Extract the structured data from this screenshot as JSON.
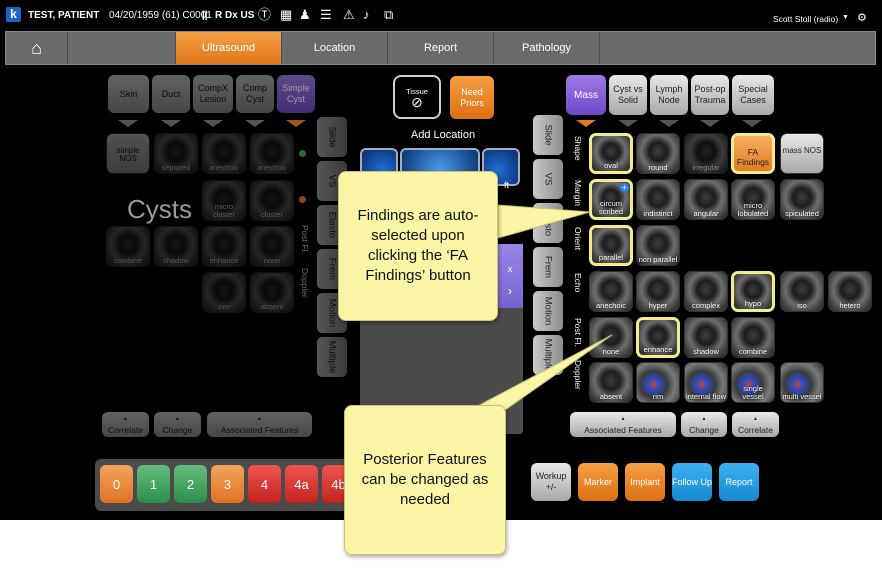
{
  "header": {
    "logo": "k",
    "patient_name": "TEST, PATIENT",
    "patient_info": "04/20/1959 (61) C0001",
    "separator": "||",
    "mode": "R Dx US",
    "user": "Scott Stoll (radio)"
  },
  "nav": {
    "tabs": [
      "Ultrasound",
      "Location",
      "Report",
      "Pathology"
    ],
    "active": "Ultrasound"
  },
  "left_panel": {
    "categories": [
      {
        "label": "Skin",
        "style": "gray"
      },
      {
        "label": "Duct",
        "style": "gray"
      },
      {
        "label": "CompX Lesion",
        "style": "gray"
      },
      {
        "label": "Comp Cyst",
        "style": "gray"
      },
      {
        "label": "Simple Cyst",
        "style": "purple"
      }
    ],
    "side_tabs": [
      "Slide",
      "VS",
      "Elasto",
      "Frem",
      "Motion",
      "Multiple"
    ],
    "row_labels": [
      "Post Fl.",
      "Doppler"
    ],
    "big_label": "Cysts",
    "tiles": [
      "simple NOS",
      "septated",
      "anechoic",
      "micro cluster",
      "cluster",
      "combine",
      "shadow",
      "enhance",
      "none",
      "rim",
      "absent"
    ],
    "bottom_buttons": [
      "Correlate",
      "Change",
      "Associated Features"
    ]
  },
  "middle_panel": {
    "tissue_label": "Tissue",
    "need_priors": "Need Priors",
    "add_location": "Add Location",
    "partial_text": "ft",
    "partial_x": "x"
  },
  "right_panel": {
    "categories": [
      {
        "label": "Mass",
        "style": "purple"
      },
      {
        "label": "Cyst vs Solid",
        "style": "gray"
      },
      {
        "label": "Lymph Node",
        "style": "gray"
      },
      {
        "label": "Post-op Trauma",
        "style": "gray"
      },
      {
        "label": "Special Cases",
        "style": "gray"
      }
    ],
    "side_tabs": [
      "Slide",
      "VS",
      "Elasto",
      "Frem",
      "Motion",
      "Multiple"
    ],
    "row_labels": [
      "Shape",
      "Margin",
      "Orient",
      "Echo",
      "Post Fl.",
      "Doppler"
    ],
    "shape": [
      "oval",
      "round",
      "irregular",
      "FA Findings",
      "mass NOS"
    ],
    "margin": [
      "circum scribed",
      "indistinct",
      "angular",
      "micro lobulated",
      "spiculated"
    ],
    "orient": [
      "parallel",
      "non parallel"
    ],
    "echo": [
      "anechoic",
      "hyper",
      "complex",
      "hypo",
      "iso",
      "hetero"
    ],
    "post": [
      "none",
      "enhance",
      "shadow",
      "combine"
    ],
    "doppler": [
      "absent",
      "rim",
      "internal flow",
      "single vessel",
      "multi vessel"
    ],
    "bottom_buttons": [
      "Associated Features",
      "Change",
      "Correlate"
    ]
  },
  "birads": [
    "0",
    "1",
    "2",
    "3",
    "4",
    "4a",
    "4b"
  ],
  "actions": [
    "Workup +/-",
    "Marker",
    "Implant",
    "Follow Up",
    "Report"
  ],
  "callouts": {
    "top": "Findings are auto-selected upon clicking the ‘FA Findings’ button",
    "bottom": "Posterior Features can be changed as needed"
  },
  "colors": {
    "accent_orange": "#e27a24",
    "accent_purple": "#7b56d4",
    "selected_outline": "#f3ec8c",
    "callout_bg": "#fbf5a6"
  }
}
